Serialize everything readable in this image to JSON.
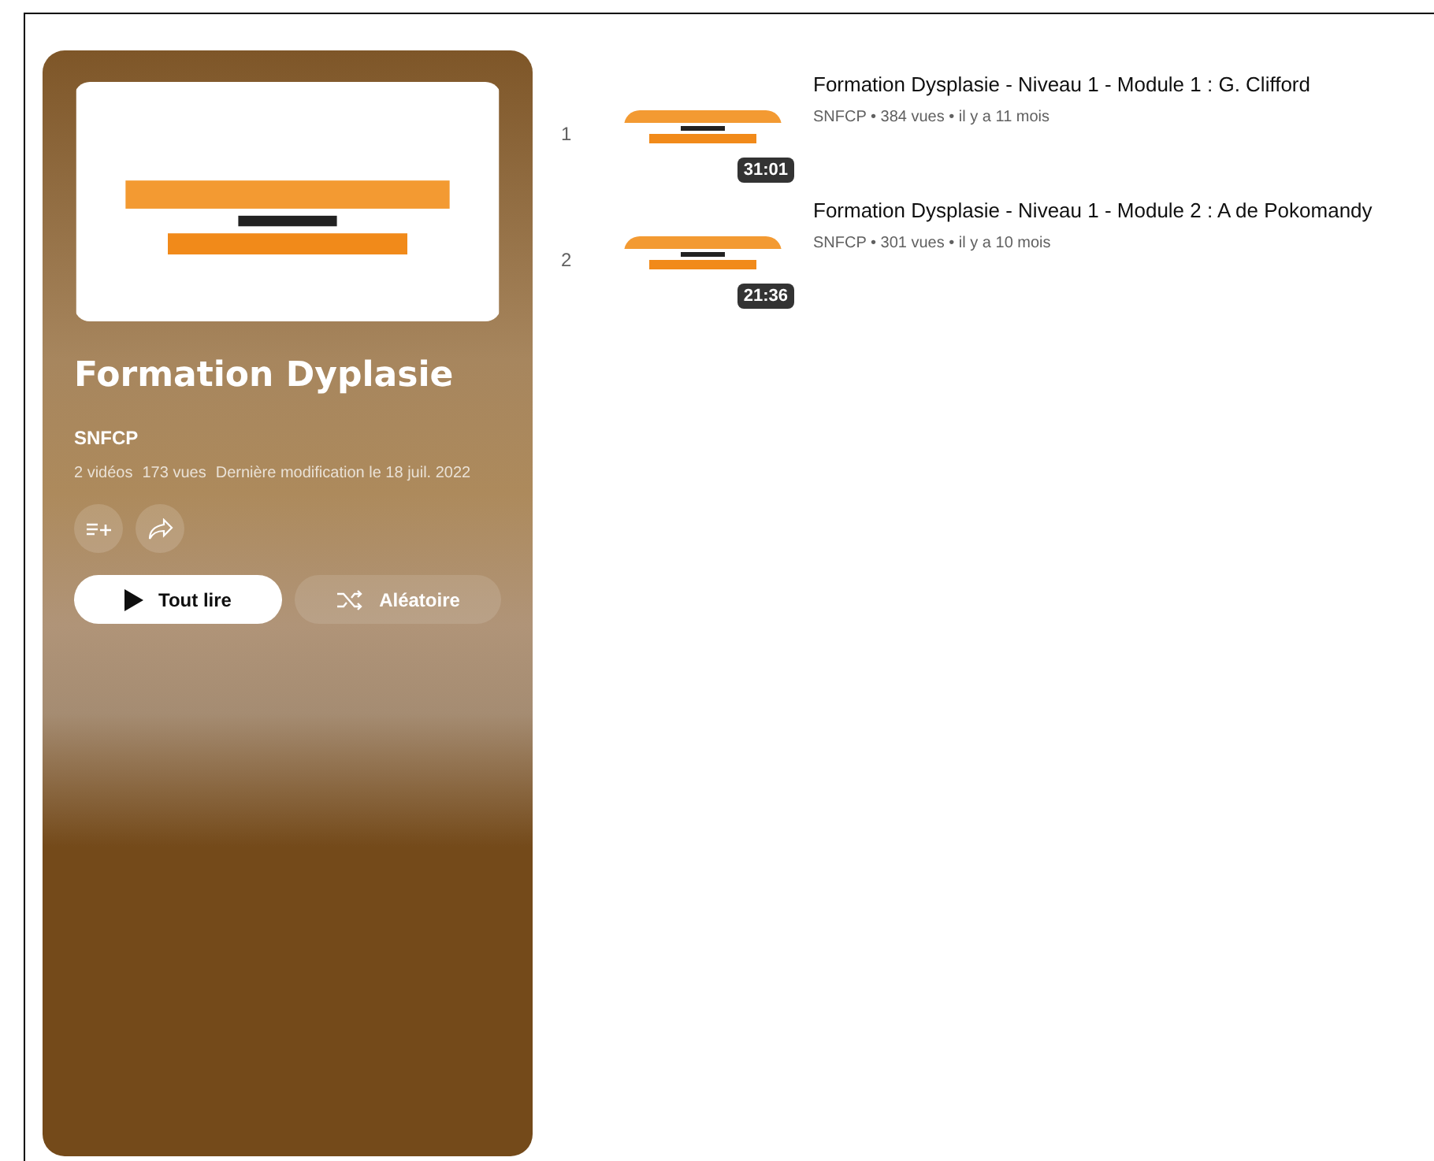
{
  "playlist": {
    "title": "Formation Dyplasie",
    "owner": "SNFCP",
    "stats": [
      "2 vidéos",
      "173 vues",
      "Dernière modification le 18 juil. 2022"
    ],
    "buttons": [
      {
        "kind": "play",
        "label": "Tout lire"
      },
      {
        "kind": "shuffle",
        "label": "Aléatoire"
      }
    ]
  },
  "videos": [
    {
      "index": "1",
      "duration": "31:01",
      "title": "Formation Dysplasie - Niveau 1 - Module 1 : G. Clifford",
      "meta": "SNFCP • 384 vues • il y a 11 mois"
    },
    {
      "index": "2",
      "duration": "21:36",
      "title": "Formation Dysplasie - Niveau 1 - Module 2 : A de Pokomandy",
      "meta": "SNFCP • 301 vues • il y a 10 mois"
    }
  ]
}
